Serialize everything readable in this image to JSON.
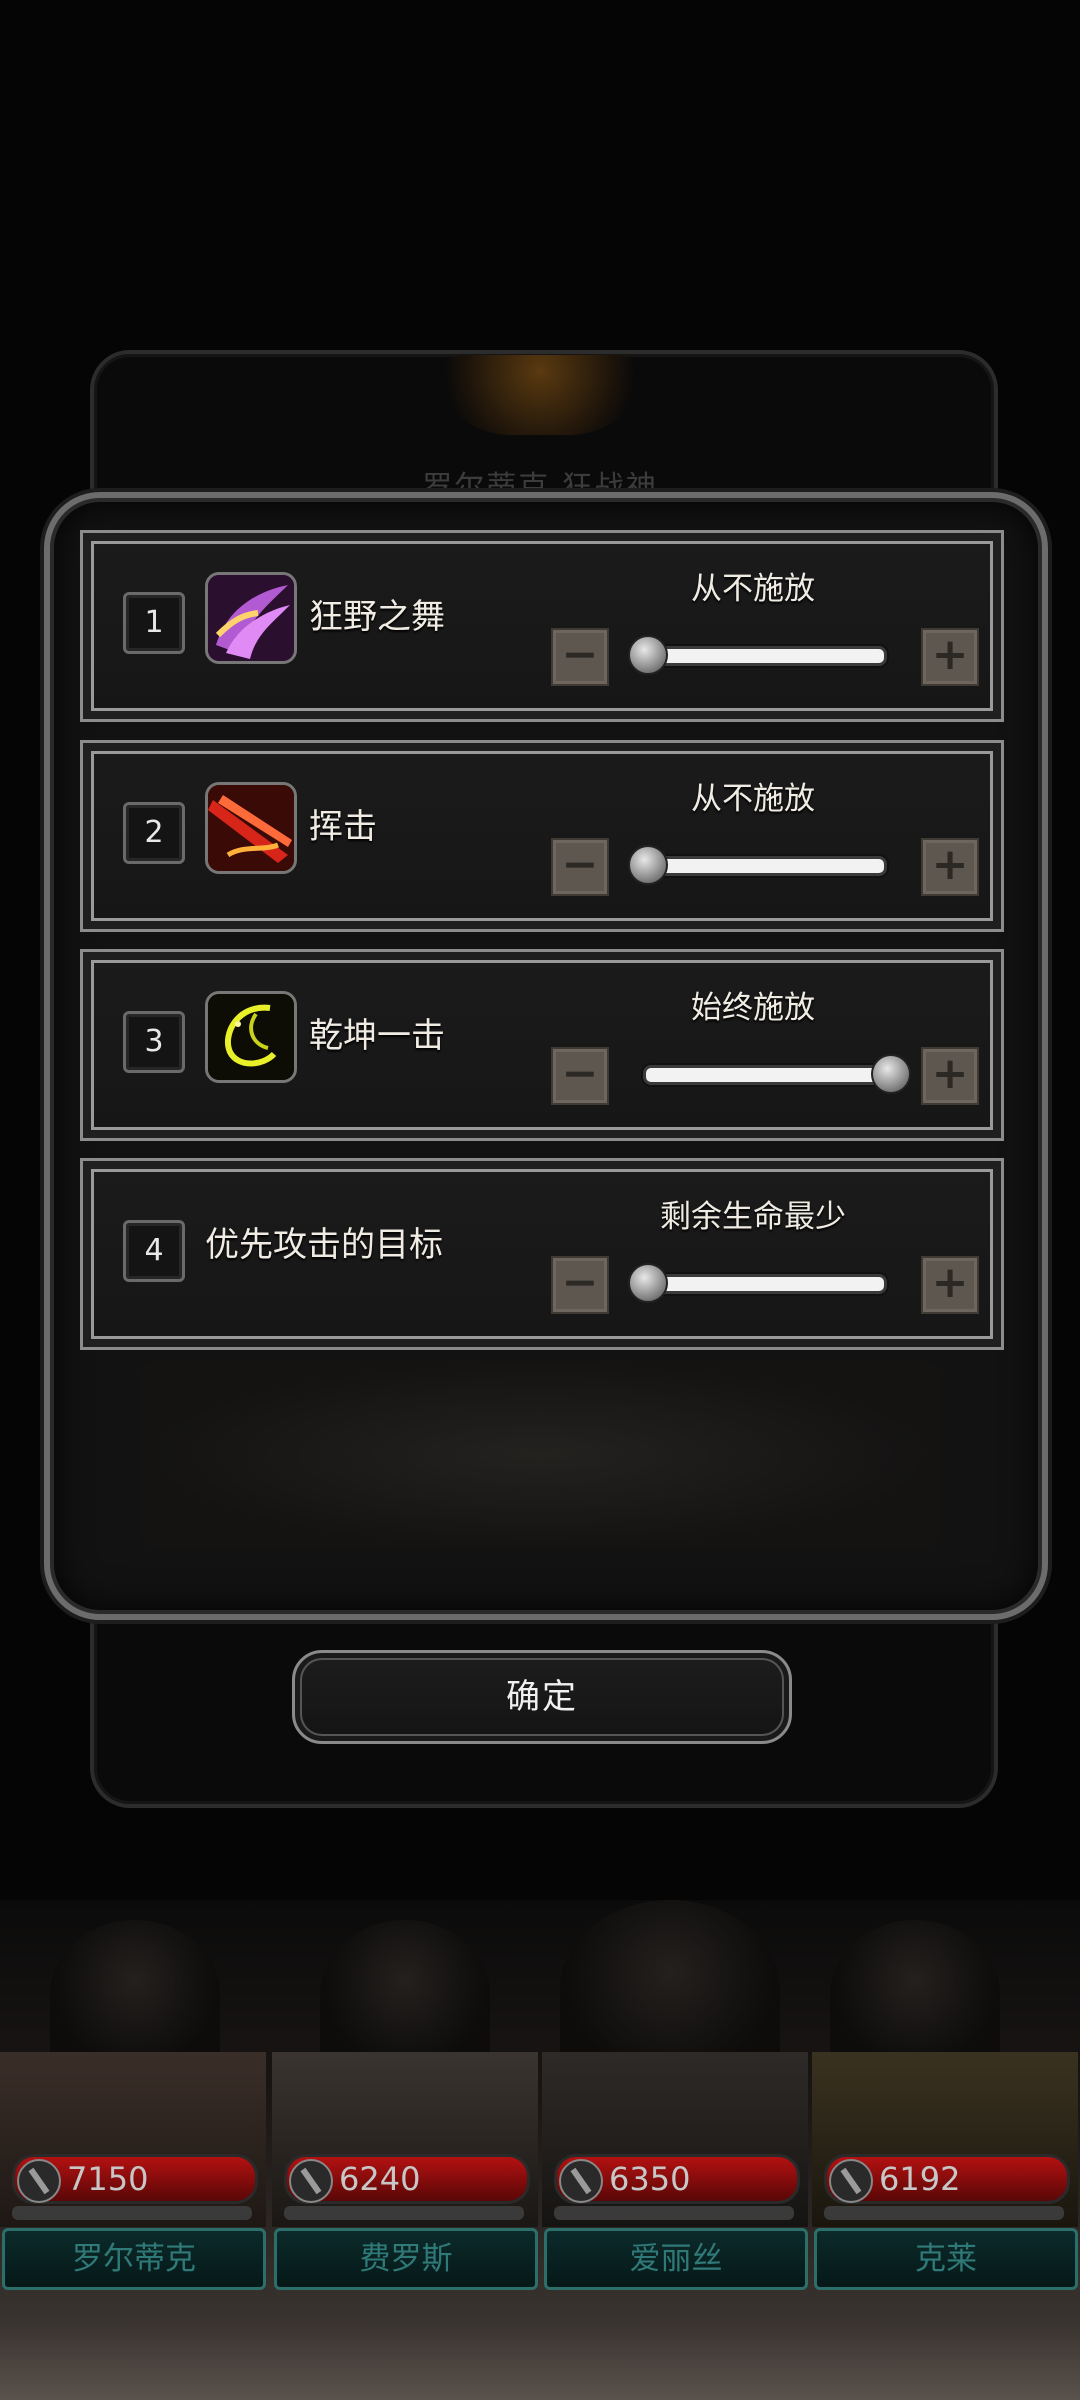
{
  "dialog": {
    "title_behind": "罗尔蒂克 狂战神",
    "confirm_label": "确定",
    "rows": [
      {
        "index": "1",
        "icon": "wild-dance-skill-icon",
        "name": "狂野之舞",
        "setting": "从不施放",
        "level": 0
      },
      {
        "index": "2",
        "icon": "slash-skill-icon",
        "name": "挥击",
        "setting": "从不施放",
        "level": 0
      },
      {
        "index": "3",
        "icon": "universe-strike-skill-icon",
        "name": "乾坤一击",
        "setting": "始终施放",
        "level": 1
      },
      {
        "index": "4",
        "icon": "",
        "name": "优先攻击的目标",
        "setting": "剩余生命最少",
        "level": 0
      }
    ]
  },
  "heroes": [
    {
      "hp": "7150",
      "name": "罗尔蒂克"
    },
    {
      "hp": "6240",
      "name": "费罗斯"
    },
    {
      "hp": "6350",
      "name": "爱丽丝"
    },
    {
      "hp": "6192",
      "name": "克莱"
    }
  ],
  "colors": {
    "hp_bar": "#b31111",
    "name_plate_border": "#2c6e6a",
    "frame": "#8c8c8c"
  }
}
